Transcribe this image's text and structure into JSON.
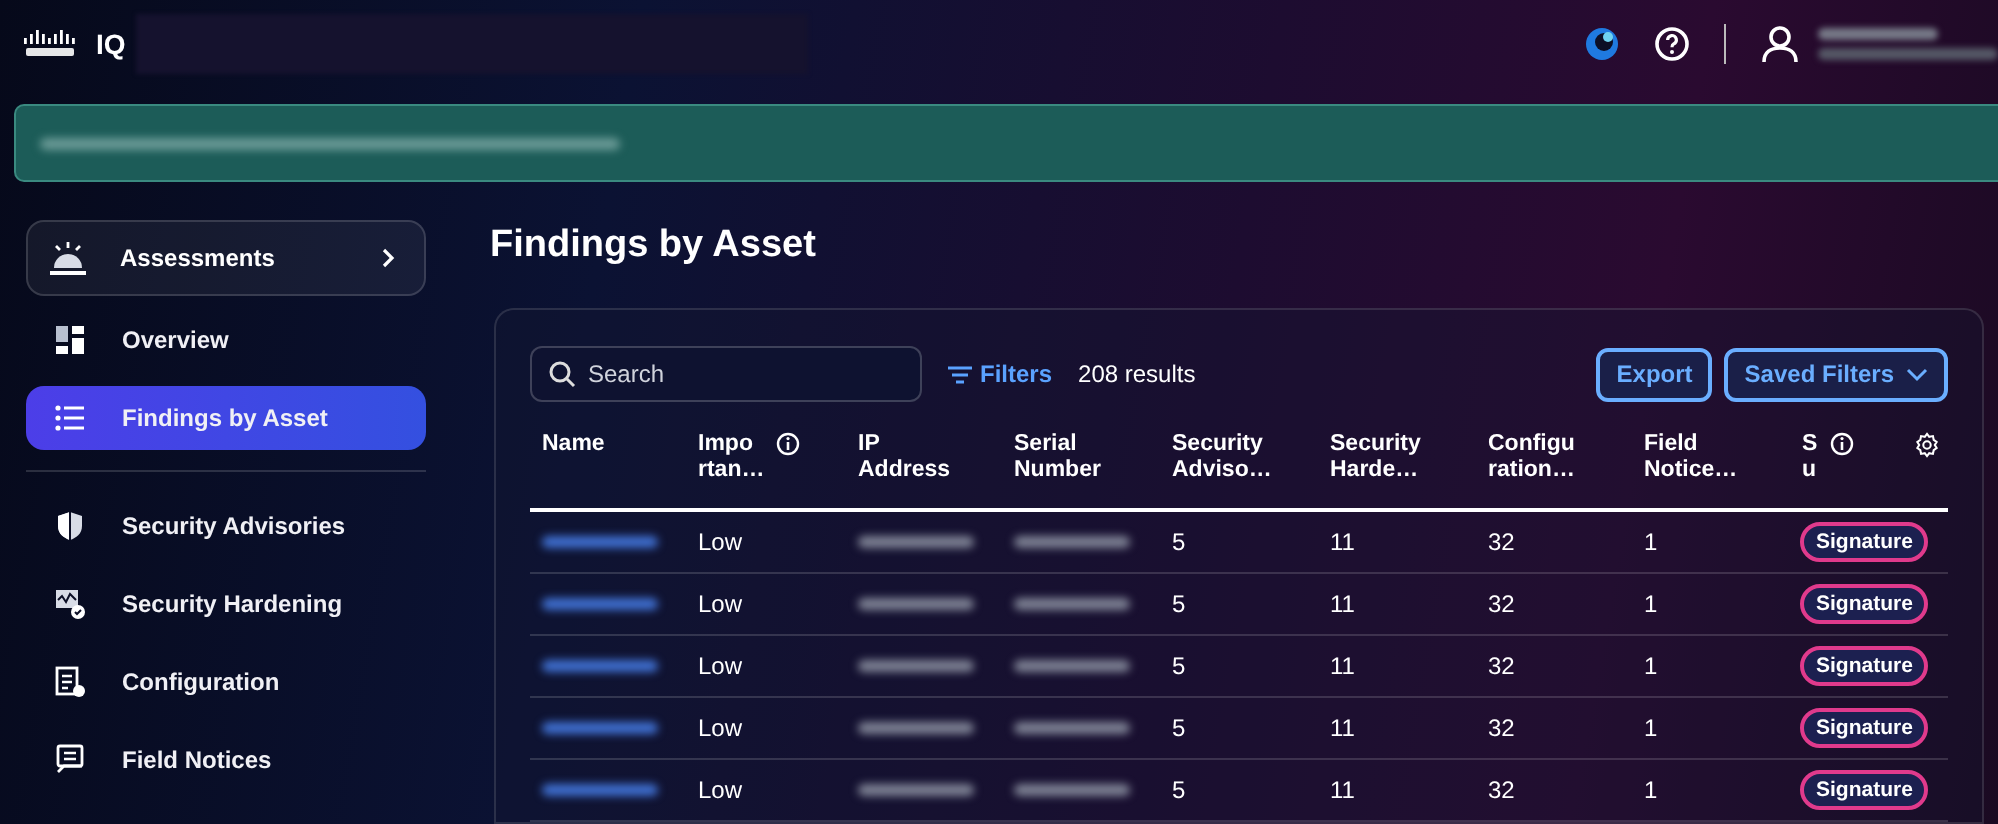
{
  "header": {
    "product": "IQ"
  },
  "sidebar": {
    "items": [
      {
        "label": "Assessments",
        "kind": "group",
        "selected": false
      },
      {
        "label": "Overview",
        "kind": "link",
        "selected": false
      },
      {
        "label": "Findings by Asset",
        "kind": "link",
        "selected": true
      },
      {
        "label": "Security Advisories",
        "kind": "link",
        "selected": false,
        "divider_before": true
      },
      {
        "label": "Security Hardening",
        "kind": "link",
        "selected": false
      },
      {
        "label": "Configuration",
        "kind": "link",
        "selected": false
      },
      {
        "label": "Field Notices",
        "kind": "link",
        "selected": false
      }
    ]
  },
  "page": {
    "title": "Findings by Asset"
  },
  "toolbar": {
    "search": {
      "placeholder": "Search"
    },
    "filters": "Filters",
    "results": "208 results",
    "buttons": [
      "Export",
      "Saved Filters"
    ]
  },
  "table": {
    "columns": [
      {
        "label": "Name",
        "info": false
      },
      {
        "label": "Impo rtan…",
        "info": true
      },
      {
        "label": "IP Address",
        "info": false
      },
      {
        "label": "Serial Number",
        "info": false
      },
      {
        "label": "Security Adviso…",
        "info": false
      },
      {
        "label": "Security Harde…",
        "info": false
      },
      {
        "label": "Configu ration…",
        "info": false
      },
      {
        "label": "Field Notice…",
        "info": false
      },
      {
        "label": "S u",
        "info": true
      }
    ],
    "rows": [
      {
        "importance": "Low",
        "security_advisories": "5",
        "security_hardening": "11",
        "configuration": "32",
        "field_notices": "1",
        "tag": "Signature"
      },
      {
        "importance": "Low",
        "security_advisories": "5",
        "security_hardening": "11",
        "configuration": "32",
        "field_notices": "1",
        "tag": "Signature"
      },
      {
        "importance": "Low",
        "security_advisories": "5",
        "security_hardening": "11",
        "configuration": "32",
        "field_notices": "1",
        "tag": "Signature"
      },
      {
        "importance": "Low",
        "security_advisories": "5",
        "security_hardening": "11",
        "configuration": "32",
        "field_notices": "1",
        "tag": "Signature"
      },
      {
        "importance": "Low",
        "security_advisories": "5",
        "security_hardening": "11",
        "configuration": "32",
        "field_notices": "1",
        "tag": "Signature"
      }
    ]
  }
}
